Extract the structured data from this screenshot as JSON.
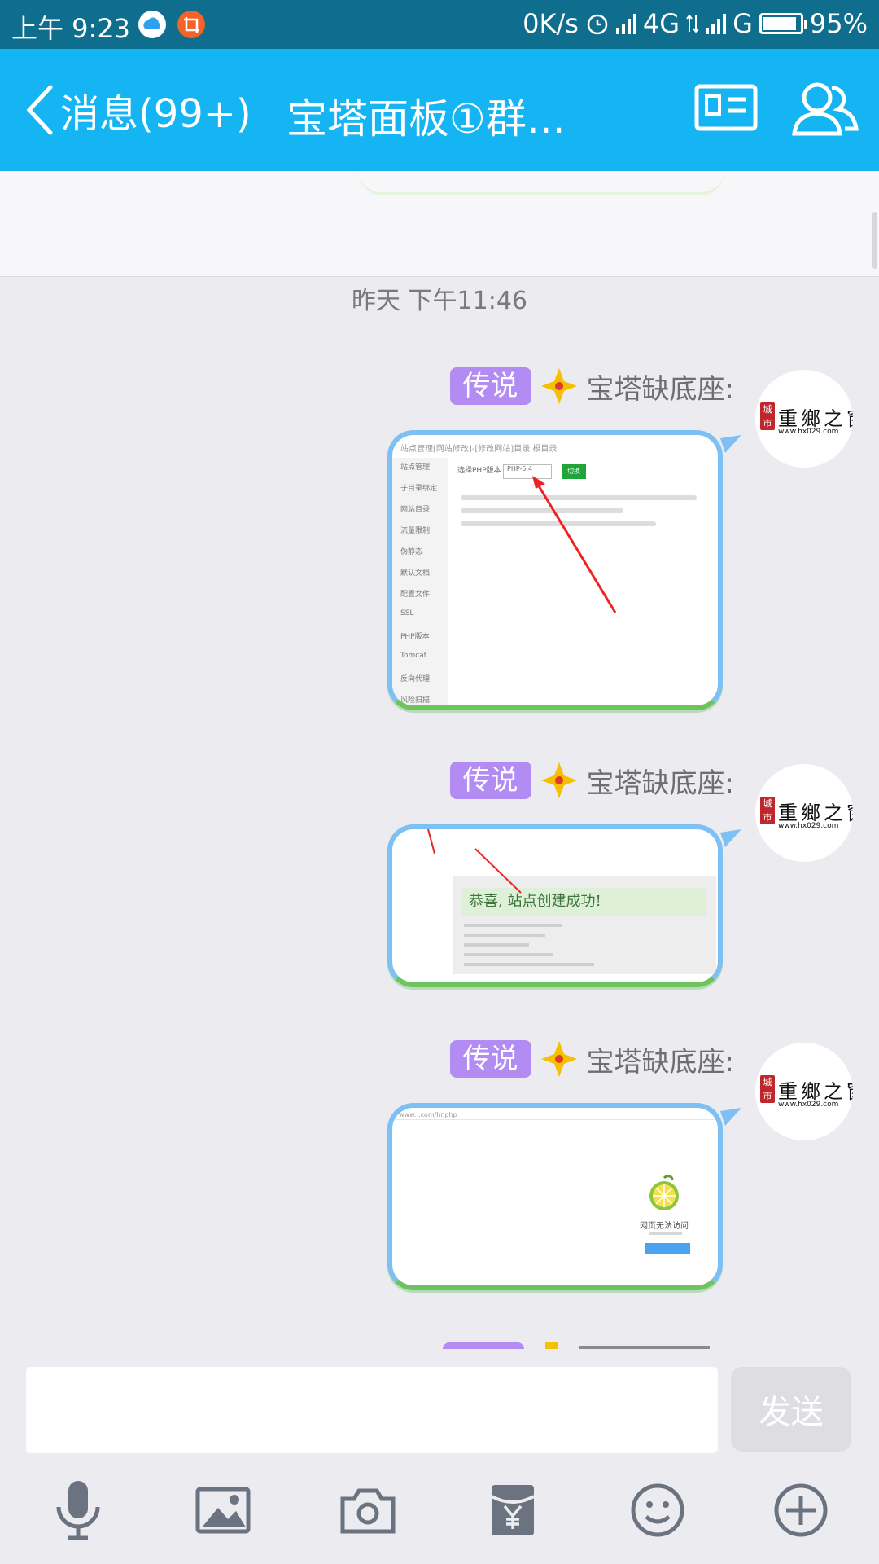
{
  "status_bar": {
    "time": "上午 9:23",
    "net_speed": "0K/s",
    "network_1": "4G",
    "network_2": "G",
    "battery": "95%"
  },
  "header": {
    "back_label": "消息(99+)",
    "title": "宝塔面板①群..."
  },
  "timestamp": "昨天 下午11:46",
  "messages": [
    {
      "badge": "传说",
      "sender": "宝塔缺底座:",
      "image": {
        "url_bar": "站点管理[网站修改]-[修改网站]目录 根目录",
        "sidebar": [
          "站点管理",
          "子目录绑定",
          "网站目录",
          "流量限制",
          "伪静态",
          "默认文档",
          "配置文件",
          "SSL",
          "PHP版本",
          "Tomcat",
          "反向代理",
          "风险扫描"
        ],
        "select_label": "选择PHP版本",
        "select_value": "PHP-5.4",
        "button": "切换"
      }
    },
    {
      "badge": "传说",
      "sender": "宝塔缺底座:",
      "image": {
        "heading": "恭喜, 站点创建成功!"
      }
    },
    {
      "badge": "传说",
      "sender": "宝塔缺底座:",
      "image": {
        "address": "www.        .com/hr.php",
        "caption": "网页无法访问"
      }
    }
  ],
  "avatar": {
    "seal": "城市",
    "calligraphy": "重鄉之窗",
    "url": "www.hx029.com"
  },
  "input": {
    "placeholder": "",
    "send_label": "发送"
  },
  "toolbar": [
    "microphone-icon",
    "image-icon",
    "camera-icon",
    "red-packet-icon",
    "emoji-icon",
    "plus-icon"
  ],
  "colors": {
    "header": "#15b4f2",
    "status_bar": "#0f6e8e",
    "badge": "#b28cf2",
    "background": "#ebebf0"
  }
}
